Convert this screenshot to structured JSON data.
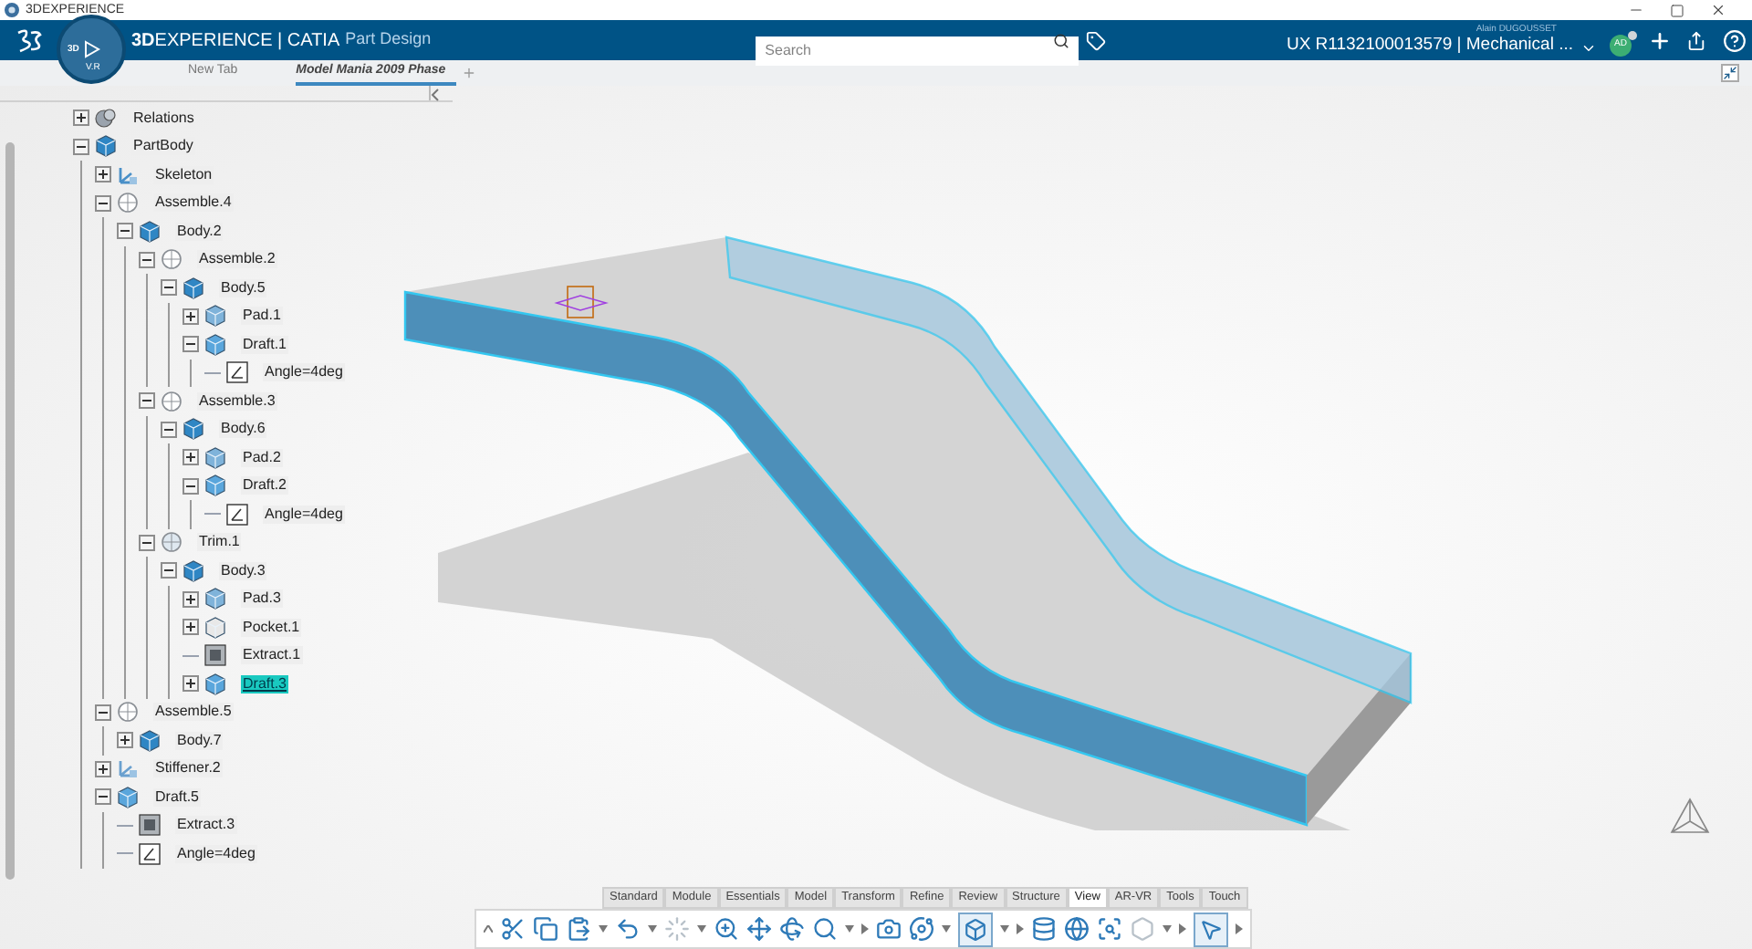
{
  "window": {
    "title": "3DEXPERIENCE"
  },
  "top_bar": {
    "brand": "**3D**EXPERIENCE | CATIA",
    "app": "Part Design",
    "compass_left": "3D",
    "compass_bottom": "V.R",
    "search": {
      "placeholder": "Search"
    },
    "user": "Alain DUGOUSSET",
    "context": "UX R1132100013579 | Mechanical ...",
    "avatar": "AD"
  },
  "tabs": [
    {
      "label": "New Tab",
      "selected": false
    },
    {
      "label": "Model Mania 2009 Phase",
      "selected": true
    }
  ],
  "tree": [
    {
      "label": "Relations",
      "kind": "relations",
      "expanded": false,
      "selected": false
    },
    {
      "label": "PartBody",
      "kind": "body",
      "expanded": true,
      "selected": false,
      "children": [
        {
          "label": "Skeleton",
          "kind": "skeleton",
          "expanded": false,
          "selected": false
        },
        {
          "label": "Assemble.4",
          "kind": "assemble",
          "expanded": true,
          "selected": false,
          "children": [
            {
              "label": "Body.2",
              "kind": "body",
              "expanded": true,
              "selected": false,
              "children": [
                {
                  "label": "Assemble.2",
                  "kind": "assemble",
                  "expanded": true,
                  "selected": false,
                  "children": [
                    {
                      "label": "Body.5",
                      "kind": "body",
                      "expanded": true,
                      "selected": false,
                      "children": [
                        {
                          "label": "Pad.1",
                          "kind": "pad",
                          "expanded": false,
                          "selected": false
                        },
                        {
                          "label": "Draft.1",
                          "kind": "draft",
                          "expanded": true,
                          "selected": false,
                          "children": [
                            {
                              "label": "Angle=4deg",
                              "kind": "parameter",
                              "selected": false
                            }
                          ]
                        }
                      ]
                    }
                  ]
                },
                {
                  "label": "Assemble.3",
                  "kind": "assemble",
                  "expanded": true,
                  "selected": false,
                  "children": [
                    {
                      "label": "Body.6",
                      "kind": "body",
                      "expanded": true,
                      "selected": false,
                      "children": [
                        {
                          "label": "Pad.2",
                          "kind": "pad",
                          "expanded": false,
                          "selected": false
                        },
                        {
                          "label": "Draft.2",
                          "kind": "draft",
                          "expanded": true,
                          "selected": false,
                          "children": [
                            {
                              "label": "Angle=4deg",
                              "kind": "parameter",
                              "selected": false
                            }
                          ]
                        }
                      ]
                    }
                  ]
                },
                {
                  "label": "Trim.1",
                  "kind": "trim",
                  "expanded": true,
                  "selected": false,
                  "children": [
                    {
                      "label": "Body.3",
                      "kind": "body",
                      "expanded": true,
                      "selected": false,
                      "children": [
                        {
                          "label": "Pad.3",
                          "kind": "pad",
                          "expanded": false,
                          "selected": false
                        },
                        {
                          "label": "Pocket.1",
                          "kind": "pocket",
                          "expanded": false,
                          "selected": false
                        },
                        {
                          "label": "Extract.1",
                          "kind": "extract",
                          "selected": false
                        },
                        {
                          "label": "Draft.3",
                          "kind": "draft",
                          "expanded": false,
                          "selected": true
                        }
                      ]
                    }
                  ]
                }
              ]
            }
          ]
        },
        {
          "label": "Assemble.5",
          "kind": "assemble",
          "expanded": true,
          "selected": false,
          "children": [
            {
              "label": "Body.7",
              "kind": "body",
              "expanded": false,
              "selected": false
            }
          ]
        },
        {
          "label": "Stiffener.2",
          "kind": "stiffener",
          "expanded": false,
          "selected": false
        },
        {
          "label": "Draft.5",
          "kind": "draft",
          "expanded": true,
          "selected": false,
          "children": [
            {
              "label": "Extract.3",
              "kind": "extract",
              "selected": false
            },
            {
              "label": "Angle=4deg",
              "kind": "parameter",
              "selected": false
            }
          ]
        }
      ]
    }
  ],
  "toolbar_tabs": [
    {
      "label": "Standard",
      "selected": false
    },
    {
      "label": "Module",
      "selected": false
    },
    {
      "label": "Essentials",
      "selected": false
    },
    {
      "label": "Model",
      "selected": false
    },
    {
      "label": "Transform",
      "selected": false
    },
    {
      "label": "Refine",
      "selected": false
    },
    {
      "label": "Review",
      "selected": false
    },
    {
      "label": "Structure",
      "selected": false
    },
    {
      "label": "View",
      "selected": true
    },
    {
      "label": "AR-VR",
      "selected": false
    },
    {
      "label": "Tools",
      "selected": false
    },
    {
      "label": "Touch",
      "selected": false
    }
  ]
}
